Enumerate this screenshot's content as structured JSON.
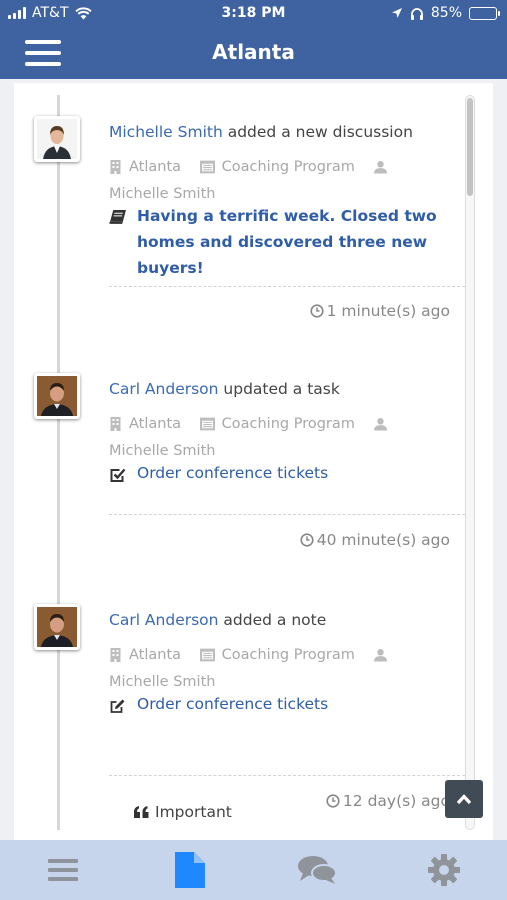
{
  "status_bar": {
    "carrier": "AT&T",
    "time": "3:18 PM",
    "battery": "85%",
    "battery_level": 0.85
  },
  "header": {
    "title": "Atlanta",
    "menu_icon": "hamburger-menu-icon"
  },
  "activities": [
    {
      "actor": "Michelle Smith",
      "action": " added a new discussion",
      "office": "Atlanta",
      "program": "Coaching Program",
      "assignee": "Michelle Smith",
      "type_icon": "book-icon",
      "subject": "Having a terrific week. Closed two homes and discovered three new buyers!",
      "time_ago": "1 minute(s) ago"
    },
    {
      "actor": "Carl Anderson",
      "action": " updated a task",
      "office": "Atlanta",
      "program": "Coaching Program",
      "assignee": "Michelle Smith",
      "type_icon": "checkbox-icon",
      "subject": "Order conference tickets",
      "time_ago": "40 minute(s) ago"
    },
    {
      "actor": "Carl Anderson",
      "action": " added a note",
      "office": "Atlanta",
      "program": "Coaching Program",
      "assignee": "Michelle Smith",
      "type_icon": "edit-icon",
      "subject": "Order conference tickets",
      "tag": "Important",
      "time_ago": "12 day(s) ago"
    }
  ],
  "tabs": [
    {
      "icon": "list-icon",
      "active": false
    },
    {
      "icon": "document-icon",
      "active": true
    },
    {
      "icon": "chat-icon",
      "active": false
    },
    {
      "icon": "gear-icon",
      "active": false
    }
  ],
  "colors": {
    "brand": "#3f63a0",
    "link": "#2f5da8",
    "tab_bar": "#c6d4ec",
    "active_tab": "#1e88ff",
    "inactive_tab": "#8e949a"
  }
}
